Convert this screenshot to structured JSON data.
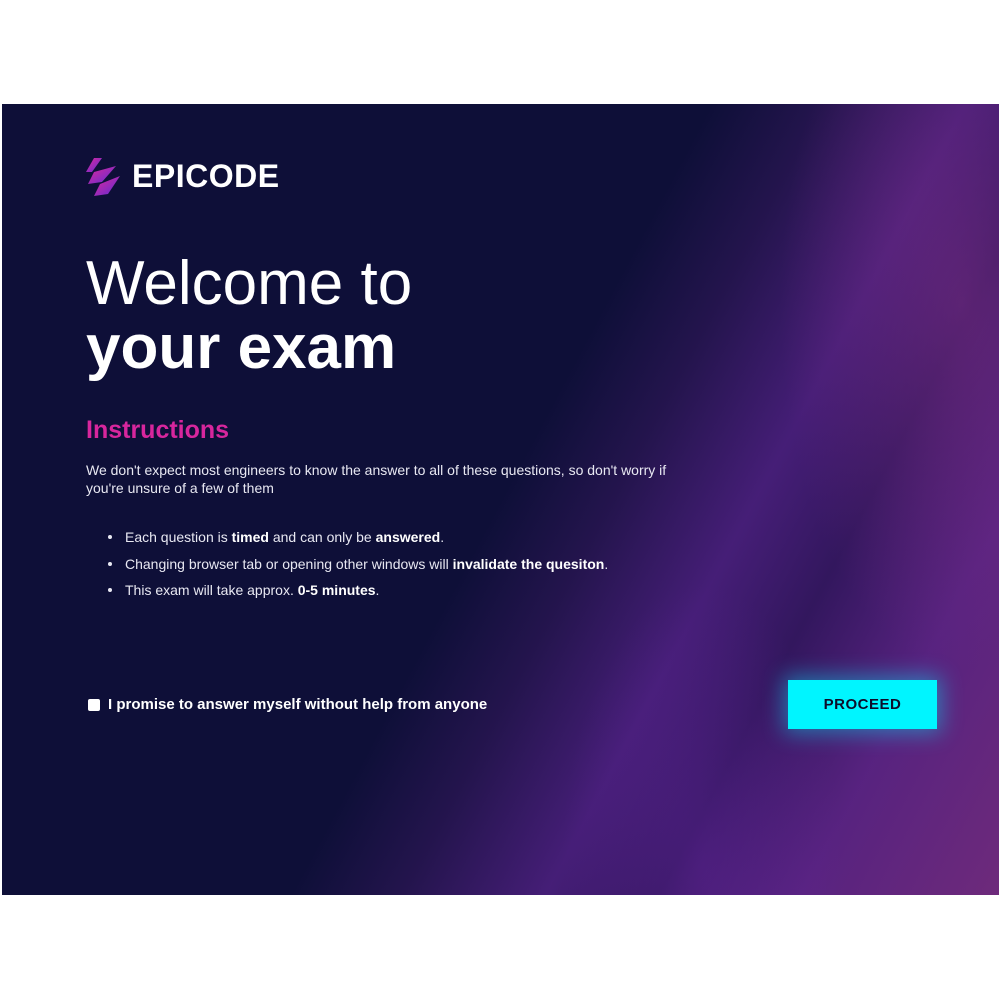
{
  "brand": {
    "name": "EPICODE",
    "logo_icon": "epicode-logo-icon"
  },
  "headline": {
    "line1": "Welcome to",
    "line2": "your exam"
  },
  "instructions": {
    "title": "Instructions",
    "intro": "We don't expect most engineers to know the answer to all of these questions, so don't worry if you're unsure of a few of them",
    "rules": [
      {
        "pre": "Each question is ",
        "b1": "timed",
        "mid": " and can only be ",
        "b2": "answered",
        "post": "."
      },
      {
        "pre": "Changing browser tab or opening other windows will ",
        "b1": "invalidate the quesiton",
        "post": "."
      },
      {
        "pre": "This exam will take approx. ",
        "b1": "0-5 minutes",
        "post": "."
      }
    ]
  },
  "promise": {
    "label": "I promise to answer myself without help from anyone",
    "checked": false
  },
  "actions": {
    "proceed_label": "PROCEED"
  },
  "colors": {
    "background": "#0e0f38",
    "accent_pink": "#d7269d",
    "button_cyan": "#00f5ff"
  }
}
